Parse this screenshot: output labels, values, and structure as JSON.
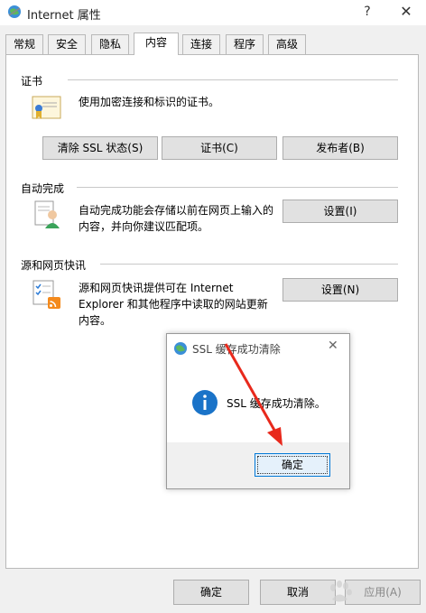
{
  "window": {
    "title": "Internet 属性",
    "help": "?",
    "close": "✕"
  },
  "tabs": [
    {
      "label": "常规"
    },
    {
      "label": "安全"
    },
    {
      "label": "隐私"
    },
    {
      "label": "内容"
    },
    {
      "label": "连接"
    },
    {
      "label": "程序"
    },
    {
      "label": "高级"
    }
  ],
  "certificates": {
    "title": "证书",
    "description": "使用加密连接和标识的证书。",
    "clear_ssl": "清除 SSL 状态(S)",
    "certs": "证书(C)",
    "publishers": "发布者(B)"
  },
  "autocomplete": {
    "title": "自动完成",
    "line1": "自动完成功能会存储以前在网页上输入的",
    "line2": "内容，并向你建议匹配项。",
    "settings": "设置(I)"
  },
  "feeds": {
    "title": "源和网页快讯",
    "line1": "源和网页快讯提供可在 Internet",
    "line2": "Explorer 和其他程序中读取的网站更新",
    "line3": "内容。",
    "settings": "设置(N)"
  },
  "bottom": {
    "ok": "确定",
    "cancel": "取消",
    "apply": "应用(A)"
  },
  "dialog": {
    "title": "SSL 缓存成功清除",
    "close": "✕",
    "message": "SSL 缓存成功清除。",
    "ok": "确定"
  },
  "colors": {
    "accent": "#0078d7",
    "arrow": "#e8291c",
    "info": "#1a73c8"
  },
  "watermark": "Baidu 经验"
}
